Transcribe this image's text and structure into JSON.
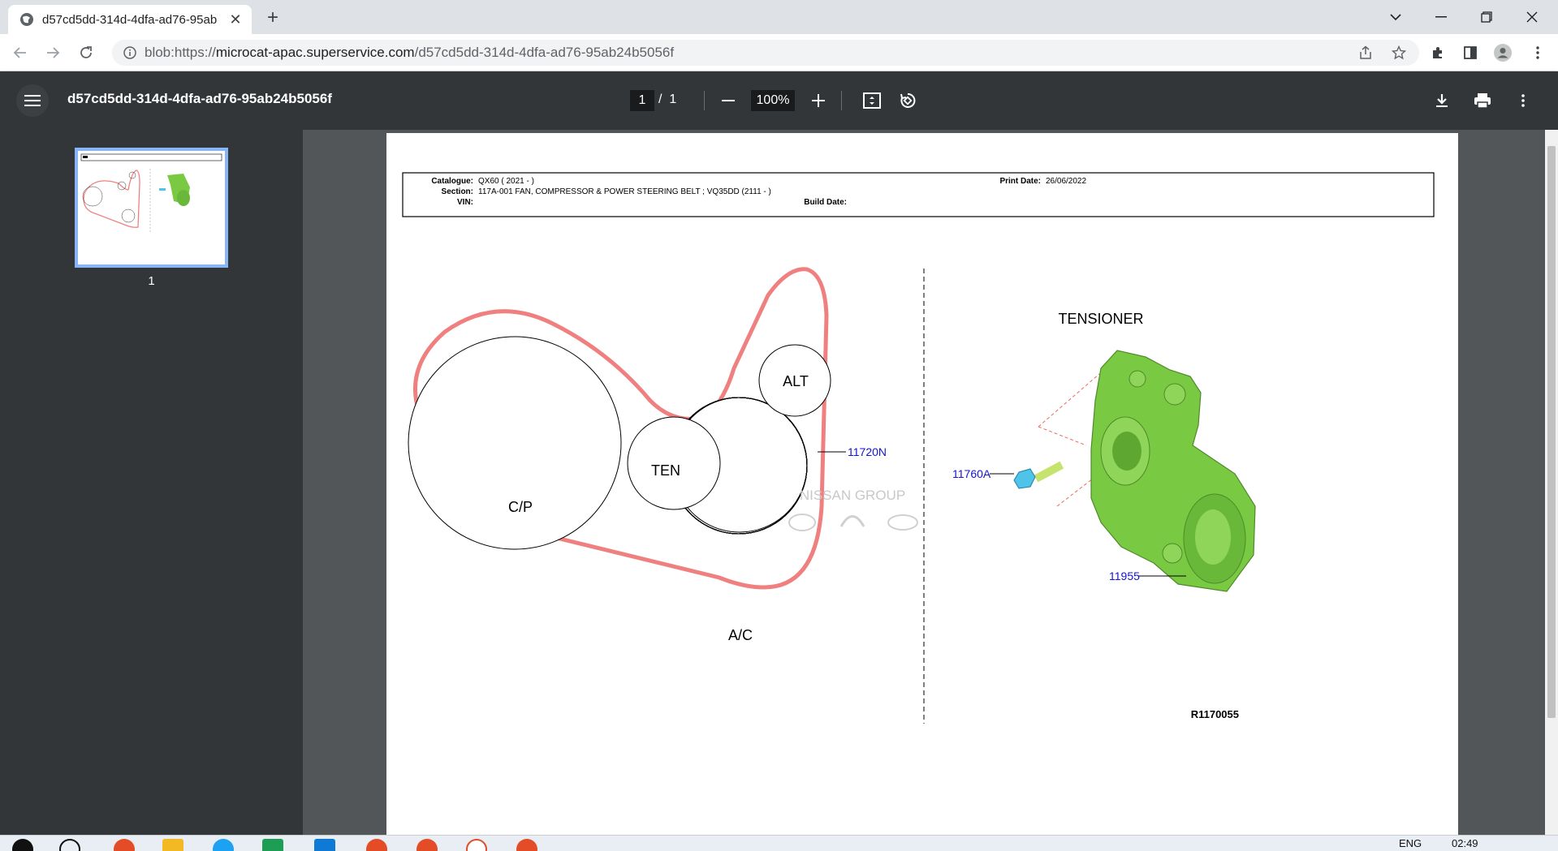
{
  "browser": {
    "tab_title": "d57cd5dd-314d-4dfa-ad76-95ab",
    "tab_close": "✕",
    "new_tab": "+",
    "url_scheme": "blob:https://",
    "url_host": "microcat-apac.superservice.com",
    "url_path": "/d57cd5dd-314d-4dfa-ad76-95ab24b5056f"
  },
  "pdf_toolbar": {
    "title": "d57cd5dd-314d-4dfa-ad76-95ab24b5056f",
    "page_current": "1",
    "page_sep": "/",
    "page_total": "1",
    "zoom": "100%"
  },
  "sidebar": {
    "thumb_label": "1"
  },
  "document": {
    "header": {
      "catalogue_label": "Catalogue:",
      "catalogue_value": "QX60 ( 2021 -  )",
      "section_label": "Section:",
      "section_value": "117A-001 FAN, COMPRESSOR & POWER STEERING BELT ; VQ35DD (2111 - )",
      "vin_label": "VIN:",
      "build_date_label": "Build Date:",
      "print_date_label": "Print Date:",
      "print_date_value": "26/06/2022"
    },
    "pulleys": {
      "cp": "C/P",
      "ten": "TEN",
      "alt": "ALT",
      "ac": "A/C"
    },
    "tensioner_title": "TENSIONER",
    "watermark": "NISSAN GROUP",
    "parts": {
      "belt": "11720N",
      "bolt": "11760A",
      "tensioner": "11955"
    },
    "figure_id": "R1170055"
  },
  "taskbar": {
    "lang": "ENG",
    "time": "02:49"
  },
  "colors": {
    "belt": "#f08080",
    "part_link": "#1414d4",
    "tensioner_body": "#7ac943",
    "bolt": "#4fc3e8"
  }
}
